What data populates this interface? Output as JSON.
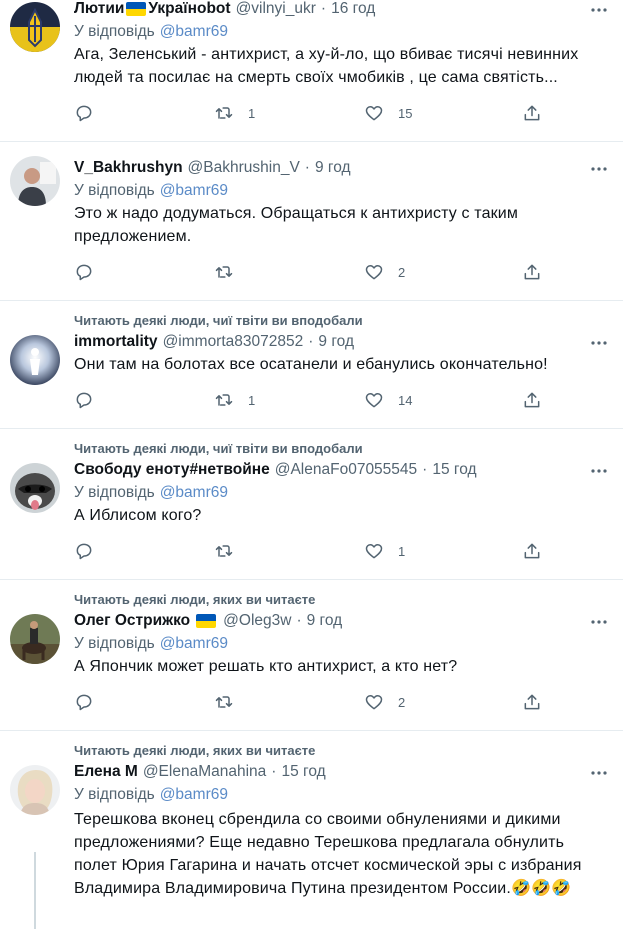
{
  "tweets": [
    {
      "name": "Лютии",
      "name_suffix": "Україноbot",
      "flag_middle": true,
      "handle": "@vilnyi_ukr",
      "dot": "·",
      "time": "16 год",
      "reply_label": "У відповідь",
      "reply_to": "@bamr69",
      "lines": [
        "Ага, Зеленський - антихрист, а ху-й-ло, що вбиває тисячі невинних",
        "людей та посилає на смерть  своїх чмобиків , це сама святість..."
      ],
      "retweets": "1",
      "likes": "15"
    },
    {
      "name": "V_Bakhrushyn",
      "handle": "@Bakhrushin_V",
      "dot": "·",
      "time": "9 год",
      "reply_label": "У відповідь",
      "reply_to": "@bamr69",
      "lines": [
        "Это ж надо додуматься. Обращаться к антихристу с таким",
        "предложением."
      ],
      "retweets": "",
      "likes": "2"
    },
    {
      "social": "Читають деякі люди, чиї твіти ви вподобали",
      "name": "immortality",
      "handle": "@immorta83072852",
      "dot": "·",
      "time": "9 год",
      "lines": [
        "Они там на болотах все осатанели и ебанулись окончательно!"
      ],
      "retweets": "1",
      "likes": "14"
    },
    {
      "social": "Читають деякі люди, чиї твіти ви вподобали",
      "name": "Свободу еноту#нетвойне",
      "handle": "@AlenaFo07055545",
      "dot": "·",
      "time": "15 год",
      "reply_label": "У відповідь",
      "reply_to": "@bamr69",
      "lines": [
        "А Иблисом кого?"
      ],
      "retweets": "",
      "likes": "1"
    },
    {
      "social": "Читають деякі люди, яких ви читаєте",
      "name": "Олег Острижко",
      "flag_after": true,
      "handle": "@Oleg3w",
      "dot": "·",
      "time": "9 год",
      "reply_label": "У відповідь",
      "reply_to": "@bamr69",
      "lines": [
        "А Япончик может решать кто антихрист, а кто нет?"
      ],
      "retweets": "",
      "likes": "2"
    },
    {
      "social": "Читають деякі люди, яких ви читаєте",
      "name": "Елена М",
      "handle": "@ElenaManahina",
      "dot": "·",
      "time": "15 год",
      "reply_label": "У відповідь",
      "reply_to": "@bamr69",
      "lines": [
        "Терешкова вконец сбрендила со своими обнулениями и дикими",
        "предложениями? Еще недавно Терешкова предлагала обнулить",
        "полет Юрия Гагарина и начать отсчет космической эры с избрания",
        "Владимира Владимировича Путина президентом России.🤣🤣🤣"
      ]
    }
  ],
  "colors": {
    "text": "#0f1419",
    "secondary": "#536471",
    "mention": "#5b8bc7",
    "divider": "#e6ecf0",
    "flag_blue": "#0057b7",
    "flag_yellow": "#ffd700"
  }
}
